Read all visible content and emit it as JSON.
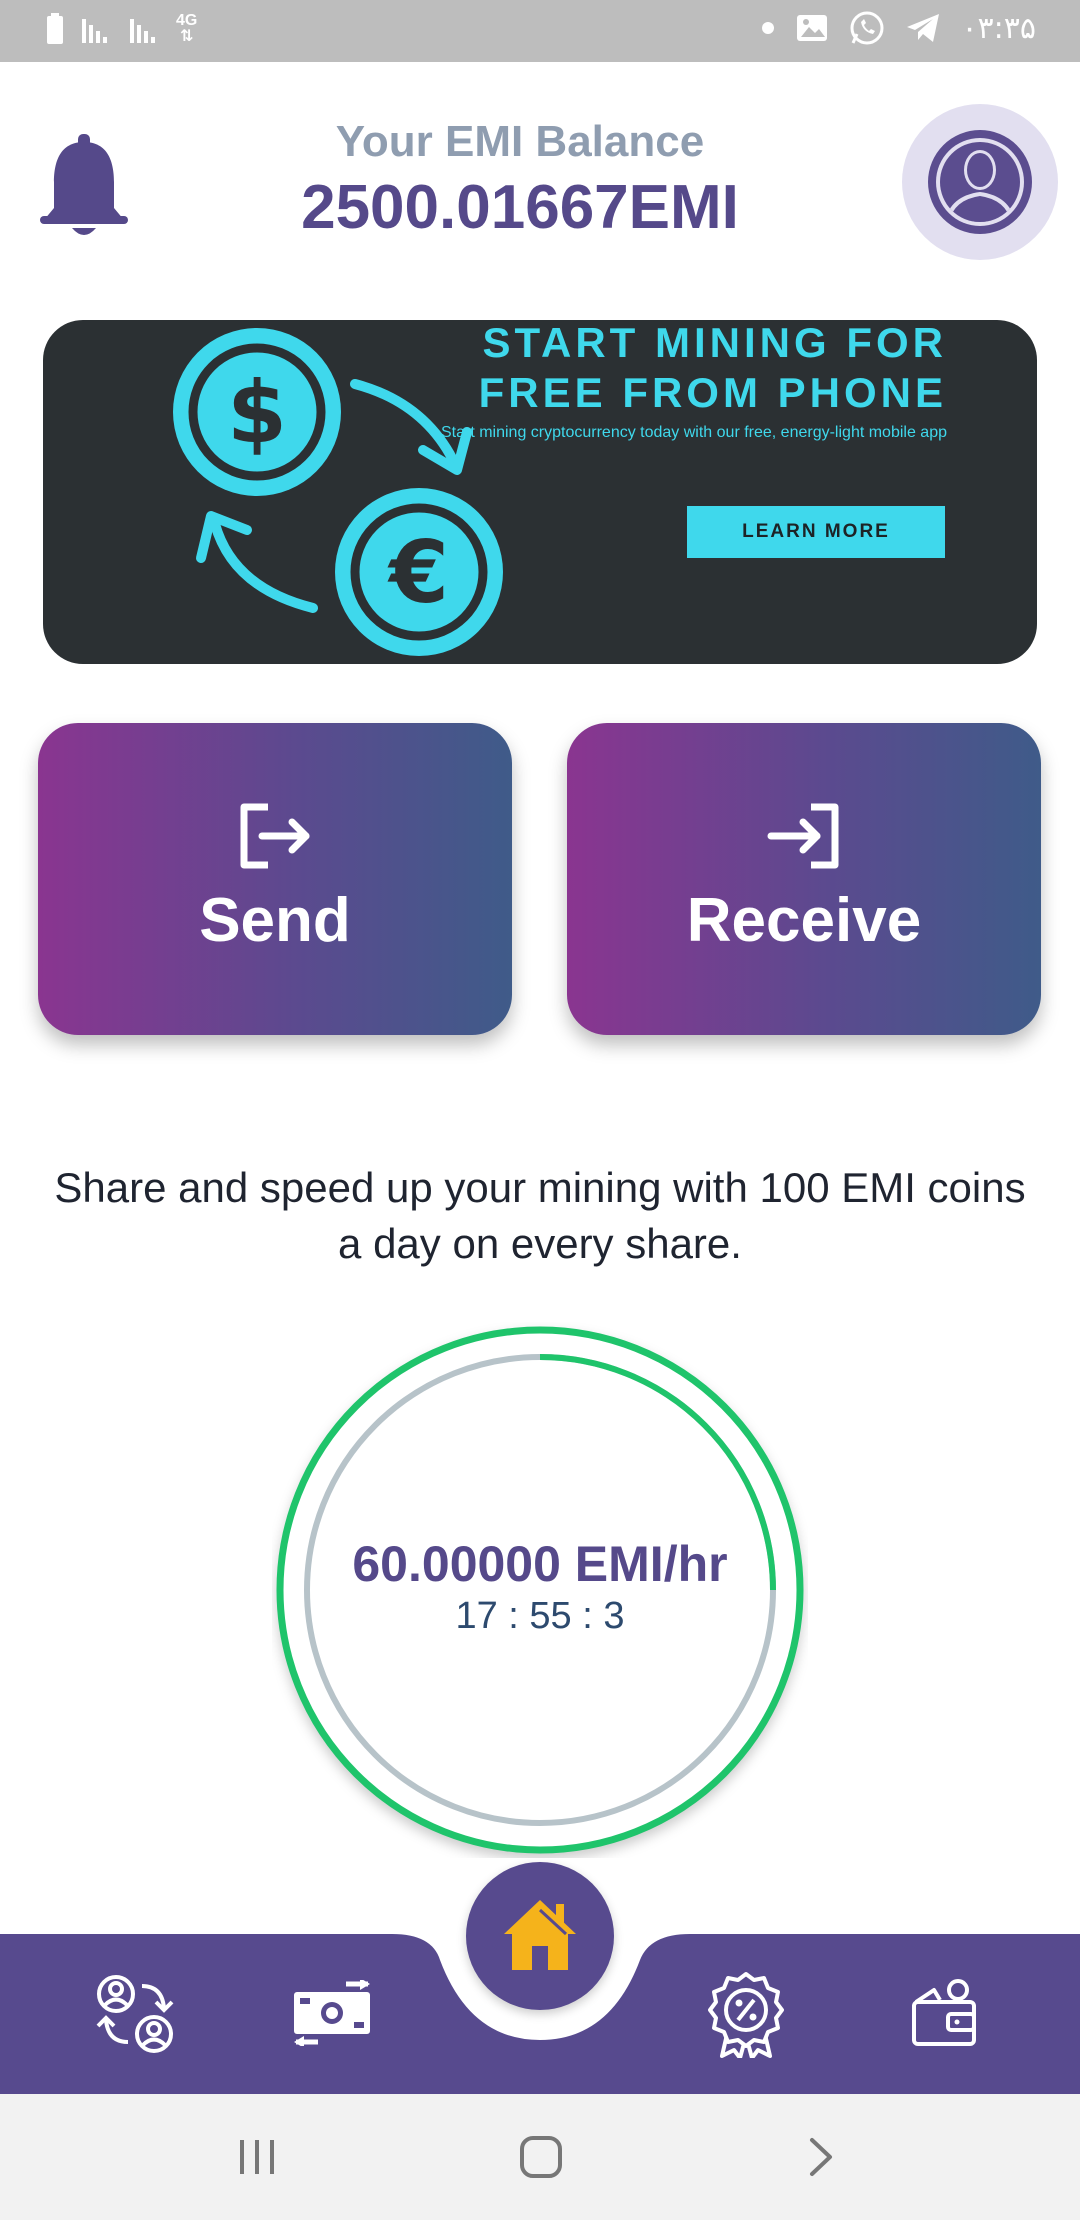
{
  "status_bar": {
    "network_label": "4G",
    "time": "۰۳:۳۵"
  },
  "header": {
    "balance_label": "Your EMI Balance",
    "balance_value": "2500.01667EMI"
  },
  "banner": {
    "title_line1": "START MINING FOR",
    "title_line2": "FREE FROM PHONE",
    "subtitle": "Start mining cryptocurrency today with our free, energy-light mobile app",
    "button_label": "LEARN MORE",
    "accent_color": "#3fd8ec"
  },
  "actions": {
    "send_label": "Send",
    "receive_label": "Receive"
  },
  "share": {
    "text": "Share and speed up your mining with 100 EMI coins a day on every share."
  },
  "mining": {
    "rate": "60.00000 EMI/hr",
    "timer": "17 : 55 : 3",
    "progress_fraction": 0.25,
    "progress_color": "#1fc46b"
  },
  "bottom_nav": {
    "items": [
      "referral-icon",
      "exchange-icon",
      "home-icon",
      "rewards-icon",
      "wallet-icon"
    ],
    "bar_color": "#574a8e",
    "home_icon_color": "#f5b31b"
  },
  "colors": {
    "brand_purple": "#55498a"
  }
}
